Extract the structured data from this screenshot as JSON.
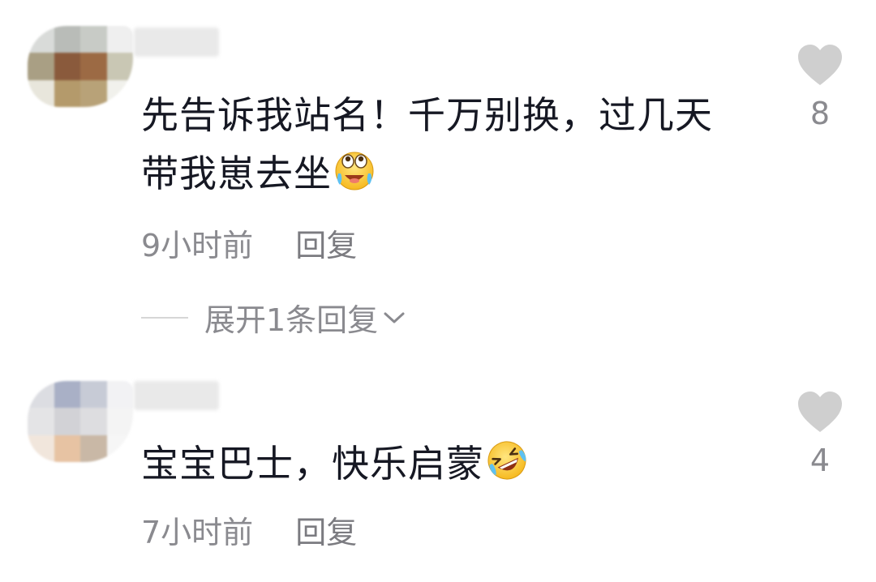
{
  "comments": [
    {
      "text": "先告诉我站名！千万别换，过几天带我崽去坐",
      "emoji": "tears-of-joy-looking-up-emoji",
      "time": "9小时前",
      "reply_label": "回复",
      "likes": "8",
      "expand_label": "展开1条回复"
    },
    {
      "text": "宝宝巴士，快乐启蒙",
      "emoji": "rolling-laughing-emoji",
      "time": "7小时前",
      "reply_label": "回复",
      "likes": "4"
    }
  ],
  "icons": {
    "like": "heart-icon",
    "expand": "chevron-down-icon"
  },
  "colors": {
    "text": "#161823",
    "meta": "#8a8a8f",
    "heart": "#cfcfcf"
  }
}
